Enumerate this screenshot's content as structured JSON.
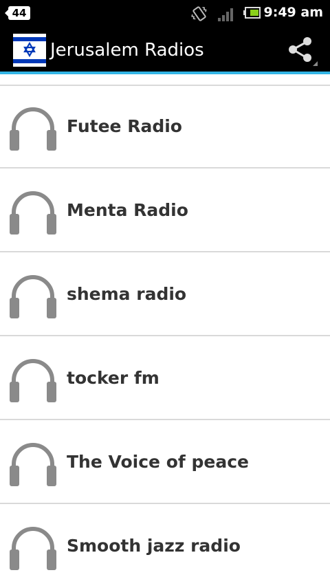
{
  "status_bar": {
    "notification_count": "44",
    "time": "9:49 am",
    "icons": [
      "vibrate-icon",
      "signal-icon",
      "battery-icon"
    ]
  },
  "action_bar": {
    "title": "Jerusalem Radios",
    "logo": "israel-flag-icon",
    "share_icon": "share-icon",
    "accent_color": "#33b5e5"
  },
  "stations": [
    {
      "name": "Futee Radio",
      "icon": "headphones-icon"
    },
    {
      "name": "Menta Radio",
      "icon": "headphones-icon"
    },
    {
      "name": "shema radio",
      "icon": "headphones-icon"
    },
    {
      "name": "tocker fm",
      "icon": "headphones-icon"
    },
    {
      "name": "The Voice of peace",
      "icon": "headphones-icon"
    },
    {
      "name": "Smooth jazz radio",
      "icon": "headphones-icon"
    }
  ]
}
